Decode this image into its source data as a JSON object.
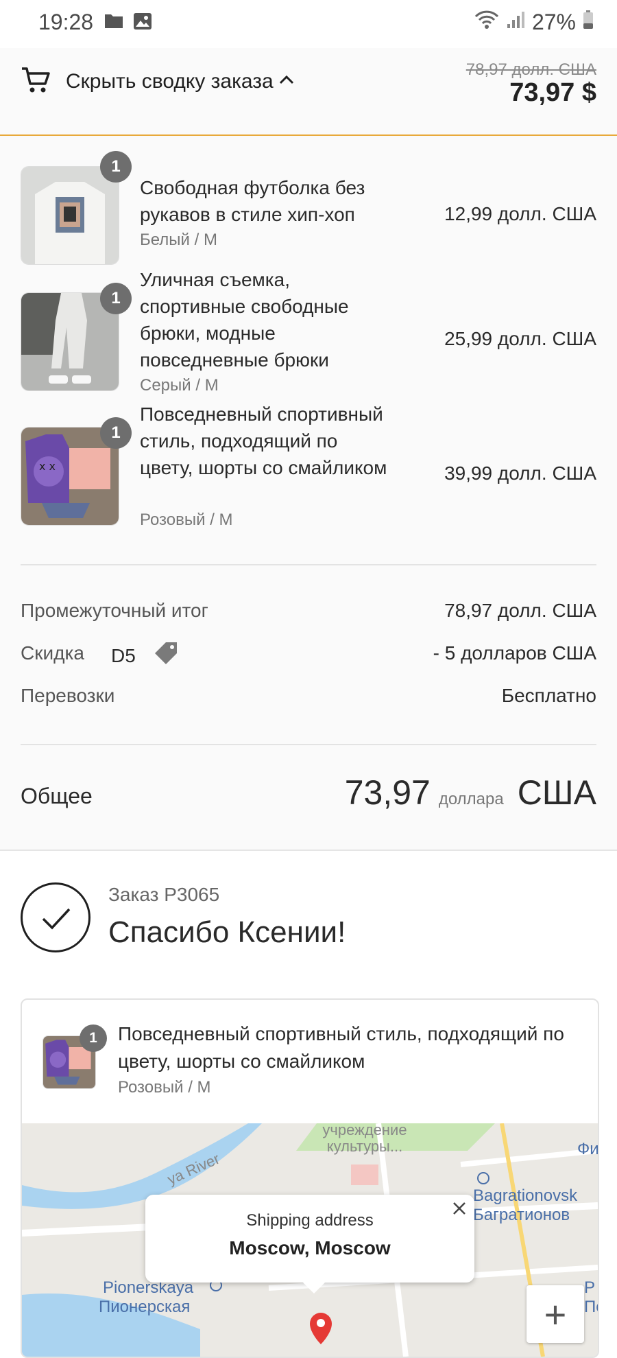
{
  "status_bar": {
    "time": "19:28",
    "battery": "27%"
  },
  "summary_bar": {
    "toggle_label": "Скрыть сводку заказа",
    "old_price": "78,97 долл. США",
    "new_price": "73,97 $"
  },
  "items": [
    {
      "qty": "1",
      "name": "Свободная футболка без рукавов в стиле хип-хоп",
      "variant": "Белый / M",
      "price": "12,99 долл. США"
    },
    {
      "qty": "1",
      "name": "Уличная съемка, спортивные свободные брюки, модные повседневные брюки",
      "variant": "Серый / M",
      "price": "25,99 долл. США"
    },
    {
      "qty": "1",
      "name": "Повседневный спортивный стиль, подходящий по цвету, шорты со смайликом",
      "variant": "Розовый / M",
      "price": "39,99 долл. США"
    }
  ],
  "totals": {
    "subtotal_label": "Промежуточный итог",
    "subtotal_value": "78,97 долл. США",
    "discount_label": "Скидка",
    "discount_code": "D5",
    "discount_value": "- 5 долларов США",
    "shipping_label": "Перевозки",
    "shipping_value": "Бесплатно",
    "total_label": "Общее",
    "total_number": "73,97",
    "total_word": "доллара",
    "total_currency": "США"
  },
  "confirmation": {
    "order_number": "Заказ P3065",
    "thanks": "Спасибо Ксении!"
  },
  "card": {
    "qty": "1",
    "name": "Повседневный спортивный стиль, подходящий по цвету, шорты со смайликом",
    "variant": "Розовый / M"
  },
  "map": {
    "popup_title": "Shipping address",
    "popup_address": "Moscow, Moscow",
    "zoom_in": "+",
    "labels": {
      "institution": "учреждение культуры...",
      "river": "ya River",
      "bagration_en": "Bagrationovsk",
      "bagration_ru": "Багратионов",
      "pioner_en": "Pionerskaya",
      "pioner_ru": "Пионерская",
      "fi": "Фи",
      "p_edge": "P",
      "po_edge": "По"
    }
  },
  "colors": {
    "accent_border": "#e8a93a",
    "badge": "#6e6e6e",
    "map_pin": "#e53935"
  }
}
